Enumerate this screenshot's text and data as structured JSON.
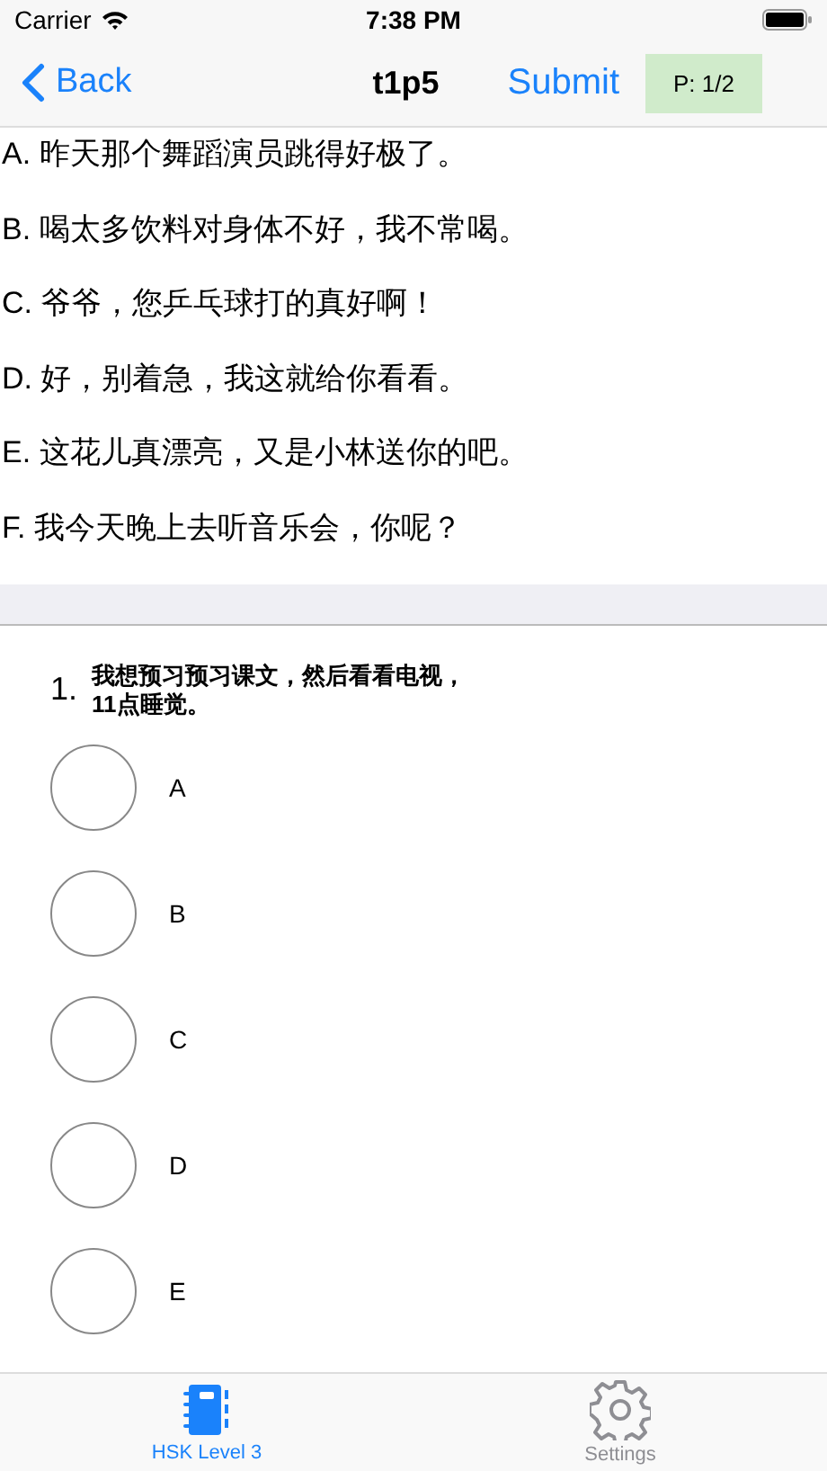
{
  "status_bar": {
    "carrier": "Carrier",
    "time": "7:38 PM"
  },
  "nav": {
    "back": "Back",
    "title": "t1p5",
    "submit": "Submit",
    "page": "P: 1/2"
  },
  "sentences": [
    "A. 昨天那个舞蹈演员跳得好极了。",
    "B. 喝太多饮料对身体不好，我不常喝。",
    "C. 爷爷，您乒乓球打的真好啊！",
    "D. 好，别着急，我这就给你看看。",
    "E. 这花儿真漂亮，又是小林送你的吧。",
    "F. 我今天晚上去听音乐会，你呢？"
  ],
  "question": {
    "number": "1.",
    "text": "我想预习预习课文，然后看看电视，11点睡觉。"
  },
  "options": [
    {
      "label": "A",
      "selected": false
    },
    {
      "label": "B",
      "selected": false
    },
    {
      "label": "C",
      "selected": false
    },
    {
      "label": "D",
      "selected": false
    },
    {
      "label": "E",
      "selected": false
    }
  ],
  "tabs": [
    {
      "label": "HSK Level 3",
      "selected": true,
      "kind": "notebook"
    },
    {
      "label": "Settings",
      "selected": false,
      "kind": "gear"
    }
  ]
}
